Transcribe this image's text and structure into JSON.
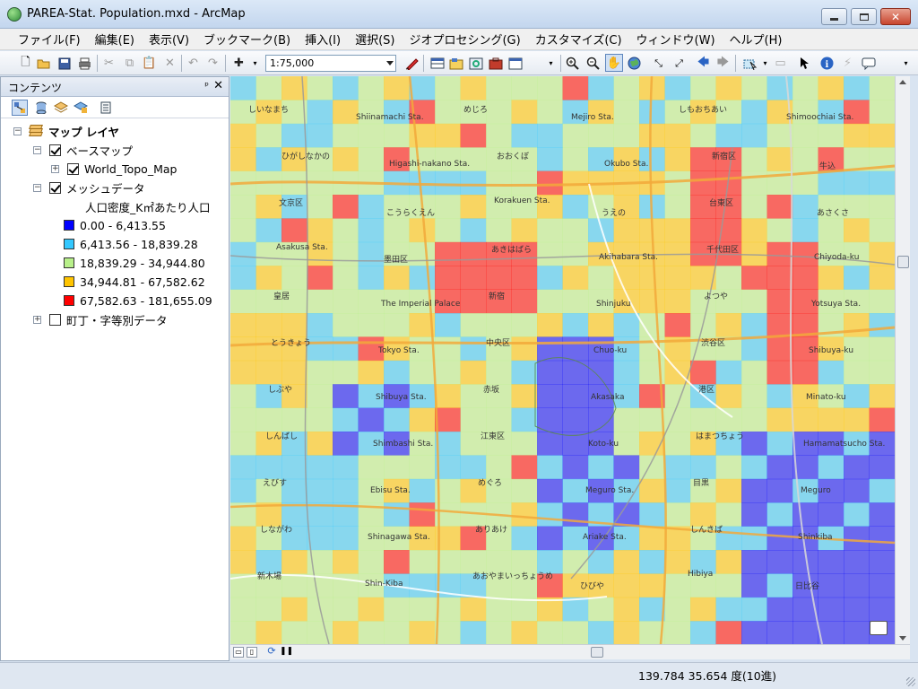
{
  "window": {
    "title": "PAREA-Stat. Population.mxd - ArcMap",
    "close_label": "✕"
  },
  "menu": {
    "items": [
      "ファイル(F)",
      "編集(E)",
      "表示(V)",
      "ブックマーク(B)",
      "挿入(I)",
      "選択(S)",
      "ジオプロセシング(G)",
      "カスタマイズ(C)",
      "ウィンドウ(W)",
      "ヘルプ(H)"
    ]
  },
  "toolbar": {
    "scale": "1:75,000",
    "icons": [
      "new-icon",
      "open-icon",
      "save-icon",
      "print-icon",
      "cut-icon",
      "copy-icon",
      "paste-icon",
      "delete-icon",
      "undo-icon",
      "redo-icon",
      "add-data-icon",
      "editor-icon",
      "table-icon",
      "catalog-icon",
      "search-icon",
      "arctoolbox-icon",
      "python-icon",
      "zoom-in-icon",
      "zoom-out-icon",
      "pan-icon",
      "full-extent-icon",
      "fixed-zoom-in-icon",
      "fixed-zoom-out-icon",
      "back-icon",
      "forward-icon",
      "select-features-icon",
      "clear-selection-icon",
      "select-elements-icon",
      "identify-icon",
      "hyperlink-icon",
      "html-popup-icon"
    ]
  },
  "toc": {
    "title": "コンテンツ",
    "pin": "ᵖ",
    "close": "✕",
    "root": "マップ レイヤ",
    "basemap_group": "ベースマップ",
    "basemap_layer": "World_Topo_Map",
    "mesh_group": "メッシュデータ",
    "mesh_field": "人口密度_K㎡あたり人口",
    "legend": [
      {
        "label": "0.00 - 6,413.55",
        "color": "#0000ff"
      },
      {
        "label": "6,413.56 - 18,839.28",
        "color": "#33c8ff"
      },
      {
        "label": "18,839.29 - 34,944.80",
        "color": "#b8f08a"
      },
      {
        "label": "34,944.81 - 67,582.62",
        "color": "#ffc400"
      },
      {
        "label": "67,582.63 - 181,655.09",
        "color": "#ff0000"
      }
    ],
    "town_group": "町丁・字等別データ"
  },
  "map": {
    "labels": [
      "しいなまち",
      "Shiinamachi Sta.",
      "めじろ",
      "Mejiro Sta.",
      "しもおちあい",
      "Shimoochiai Sta.",
      "ひがしなかの",
      "Higashi-nakano Sta.",
      "おおくぼ",
      "Okubo Sta.",
      "新宿区",
      "牛込",
      "文京区",
      "こうらくえん",
      "Korakuen Sta.",
      "うえの",
      "台東区",
      "あさくさ",
      "Asakusa Sta.",
      "墨田区",
      "あきはばら",
      "Akihabara Sta.",
      "千代田区",
      "Chiyoda-ku",
      "皇居",
      "The Imperial Palace",
      "新宿",
      "Shinjuku",
      "よつや",
      "Yotsuya Sta.",
      "とうきょう",
      "Tokyo Sta.",
      "中央区",
      "Chuo-ku",
      "渋谷区",
      "Shibuya-ku",
      "しぶや",
      "Shibuya Sta.",
      "赤坂",
      "Akasaka",
      "港区",
      "Minato-ku",
      "しんばし",
      "Shimbashi Sta.",
      "江東区",
      "Koto-ku",
      "はまつちょう",
      "Hamamatsucho Sta.",
      "えびす",
      "Ebisu Sta.",
      "めぐろ",
      "Meguro Sta.",
      "目黒",
      "Meguro",
      "しながわ",
      "Shinagawa Sta.",
      "ありあけ",
      "Ariake Sta.",
      "しんきば",
      "Shinkiba",
      "新木場",
      "Shin-Kiba",
      "あおやまいっちょうめ",
      "ひびや",
      "Hibiya",
      "日比谷"
    ]
  },
  "statusbar": {
    "coords": "139.784  35.654 度(10進)"
  }
}
